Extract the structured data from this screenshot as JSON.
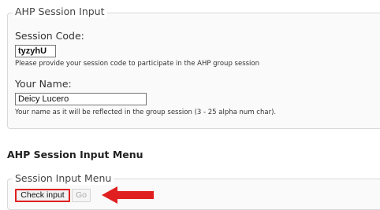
{
  "session_fieldset": {
    "legend": "AHP Session Input",
    "session_code": {
      "label": "Session Code:",
      "value": "tyzyhU",
      "hint": "Please provide your session code to participate in the AHP group session"
    },
    "your_name": {
      "label": "Your Name:",
      "value": "Deicy Lucero",
      "hint": "Your name as it will be reflected in the group session (3 - 25 alpha num char)."
    }
  },
  "menu_heading": "AHP Session Input Menu",
  "menu_fieldset": {
    "legend": "Session Input Menu",
    "check_input_label": "Check input",
    "go_label": "Go"
  },
  "annotation": {
    "arrow_icon": "red-left-arrow-icon",
    "color": "#e02020"
  }
}
